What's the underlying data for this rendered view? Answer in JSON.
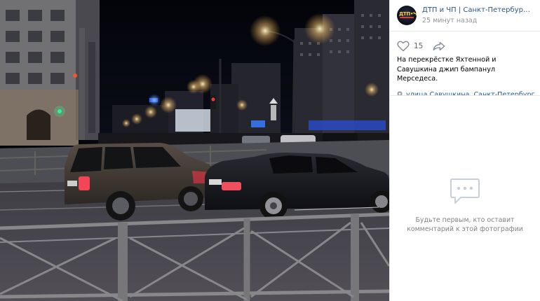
{
  "post": {
    "author": "ДТП и ЧП | Санкт-Петербург | Питер",
    "time": "25 минут назад",
    "likes": "15",
    "caption": "На перекрёстке Яхтенной и Савушкина джип бампанул Мерседеса.",
    "place": "улица Савушкина, Санкт-Петербург"
  },
  "avatar": {
    "label": "ДТП•ЧП"
  },
  "comments": {
    "empty_text": "Будьте первым, кто оставит комментарий к этой фотографии"
  },
  "icons": {
    "like": "heart-icon",
    "share": "share-arrow-icon",
    "place": "location-pin-icon",
    "comments_empty": "comment-bubble-icon"
  },
  "colors": {
    "link": "#2a5885",
    "muted": "#939393",
    "photo_bg": "#05060c"
  }
}
